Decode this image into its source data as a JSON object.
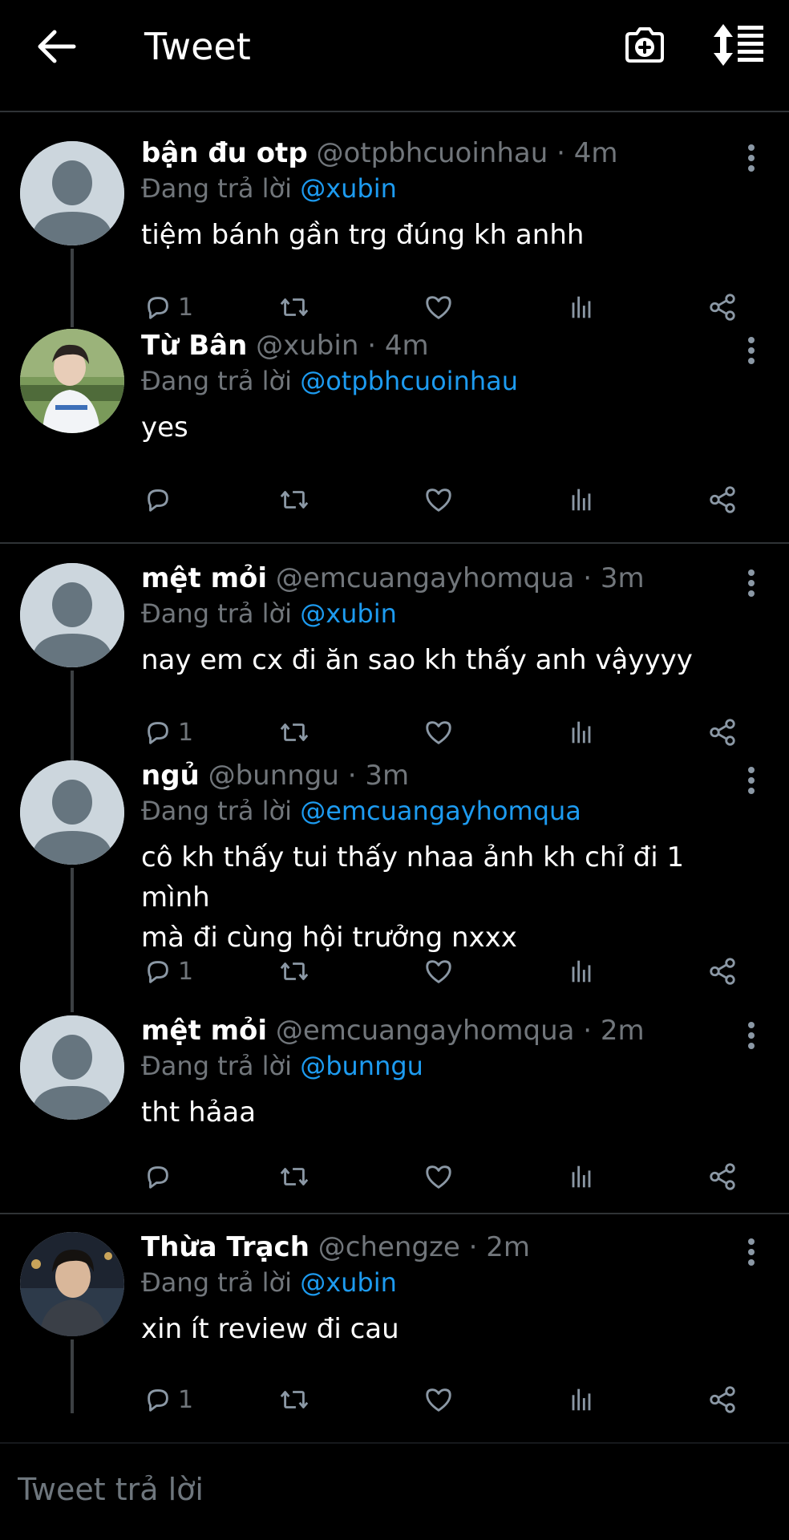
{
  "header": {
    "title": "Tweet"
  },
  "reply_prefix": "Đang trả lời",
  "tweets": [
    {
      "name": "bận đu otp",
      "handle": "@otpbhcuoinhau",
      "time": "4m",
      "reply_to": "@xubin",
      "text": "tiệm bánh gần trg đúng kh anhh",
      "reply_count": "1",
      "avatar": "default"
    },
    {
      "name": "Từ Bân",
      "handle": "@xubin",
      "time": "4m",
      "reply_to": "@otpbhcuoinhau",
      "text": "yes",
      "reply_count": "",
      "avatar": "photo-boy"
    },
    {
      "name": "mệt mỏi",
      "handle": "@emcuangayhomqua",
      "time": "3m",
      "reply_to": "@xubin",
      "text": "nay em cx đi ăn sao kh thấy anh vậyyyy",
      "reply_count": "1",
      "avatar": "default"
    },
    {
      "name": "ngủ",
      "handle": "@bunngu",
      "time": "3m",
      "reply_to": "@emcuangayhomqua",
      "text": "cô kh thấy tui thấy nhaa ảnh kh chỉ đi 1 mình\nmà đi cùng hội trưởng nxxx",
      "reply_count": "1",
      "avatar": "default"
    },
    {
      "name": "mệt mỏi",
      "handle": "@emcuangayhomqua",
      "time": "2m",
      "reply_to": "@bunngu",
      "text": "tht hảaa",
      "reply_count": "",
      "avatar": "default"
    },
    {
      "name": "Thừa Trạch",
      "handle": "@chengze",
      "time": "2m",
      "reply_to": "@xubin",
      "text": "xin ít review đi cau",
      "reply_count": "1",
      "avatar": "photo-man"
    }
  ],
  "composer": {
    "placeholder": "Tweet trả lời"
  },
  "colors": {
    "background": "#000000",
    "accent": "#1d9bf0",
    "muted": "#71767b",
    "divider": "#2f3336"
  }
}
